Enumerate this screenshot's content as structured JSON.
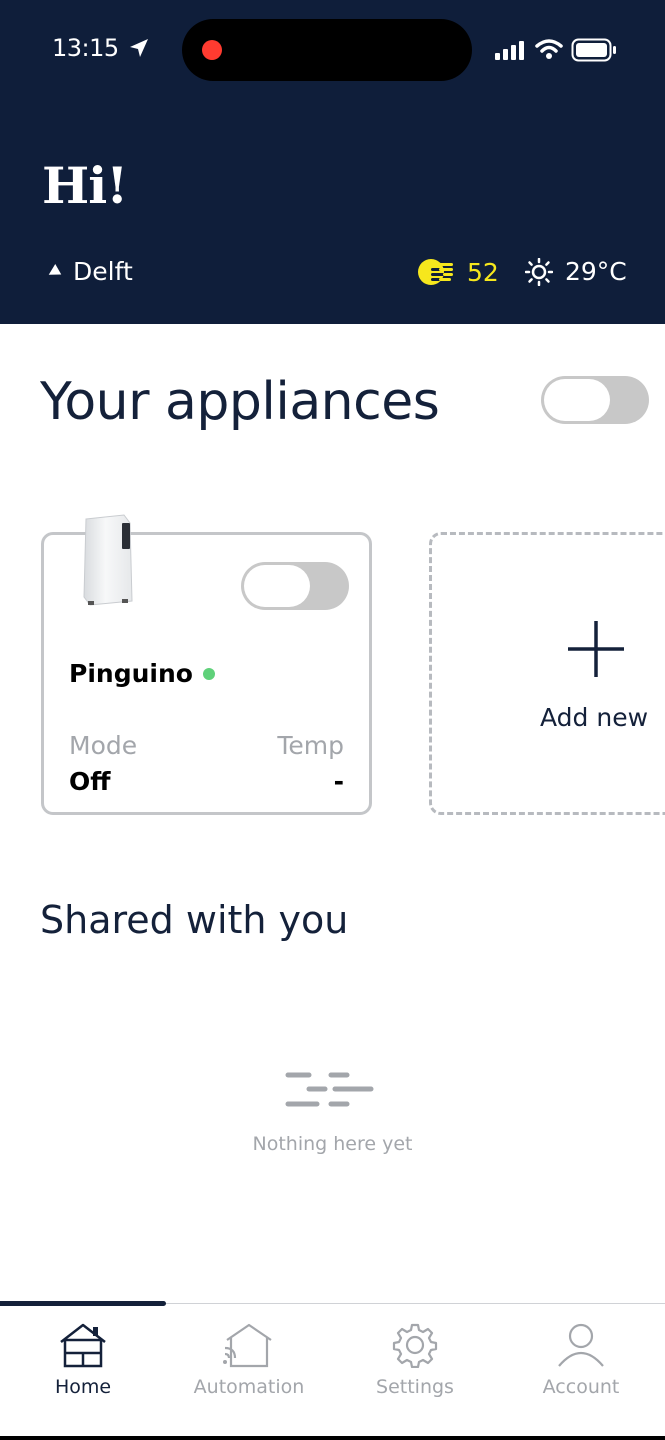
{
  "status_bar": {
    "time": "13:15",
    "icons": [
      "location-arrow-icon",
      "signal-icon",
      "wifi-icon",
      "battery-icon"
    ]
  },
  "header": {
    "greeting": "Hi!",
    "location": "Delft",
    "aqi_value": "52",
    "temperature": "29°C",
    "aqi_color": "#f6e71d"
  },
  "appliances": {
    "title": "Your appliances",
    "master_toggle_on": false,
    "cards": [
      {
        "name": "Pinguino",
        "online": true,
        "on": false,
        "mode_label": "Mode",
        "mode_value": "Off",
        "temp_label": "Temp",
        "temp_value": "-"
      }
    ],
    "add_new_label": "Add new"
  },
  "shared": {
    "title": "Shared with you",
    "empty_text": "Nothing here yet"
  },
  "tabs": [
    {
      "label": "Home",
      "icon": "home-icon",
      "active": true
    },
    {
      "label": "Automation",
      "icon": "smart-home-icon",
      "active": false
    },
    {
      "label": "Settings",
      "icon": "gear-icon",
      "active": false
    },
    {
      "label": "Account",
      "icon": "user-icon",
      "active": false
    }
  ],
  "colors": {
    "header_bg": "#0f1e3a",
    "text_dark": "#14213a",
    "status_online": "#5fd17a"
  }
}
